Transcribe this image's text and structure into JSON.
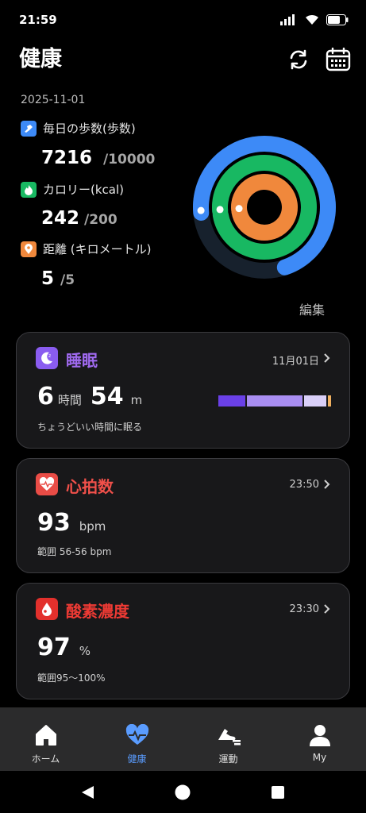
{
  "status": {
    "time": "21:59"
  },
  "header": {
    "title": "健康"
  },
  "summary": {
    "date": "2025-11-01",
    "steps": {
      "label": "毎日の歩数(歩数)",
      "value": "7216",
      "goal": "/10000",
      "progress": 0.7216,
      "color": "#3d8af7"
    },
    "calories": {
      "label": "カロリー(kcal)",
      "value": "242",
      "goal": "/200",
      "progress": 1.0,
      "color": "#18b862"
    },
    "distance": {
      "label": "距離 (キロメートル)",
      "value": "5",
      "goal": "/5",
      "progress": 1.0,
      "color": "#f0883c"
    },
    "edit_label": "編集"
  },
  "cards": {
    "sleep": {
      "title": "睡眠",
      "title_color": "#a06af0",
      "date": "11月01日",
      "hours": "6",
      "hours_unit": "時間",
      "minutes": "54",
      "minutes_unit": "m",
      "note": "ちょうどいい時間に眠る"
    },
    "heart": {
      "title": "心拍数",
      "title_color": "#f0504a",
      "time": "23:50",
      "value": "93",
      "unit": "bpm",
      "range": "範囲 56-56 bpm"
    },
    "oxygen": {
      "title": "酸素濃度",
      "title_color": "#ee3a34",
      "time": "23:30",
      "value": "97",
      "unit": "%",
      "range": "範囲95～100%"
    }
  },
  "nav": {
    "home": "ホーム",
    "health": "健康",
    "exercise": "運動",
    "my": "My",
    "active_color": "#5a9cff"
  }
}
